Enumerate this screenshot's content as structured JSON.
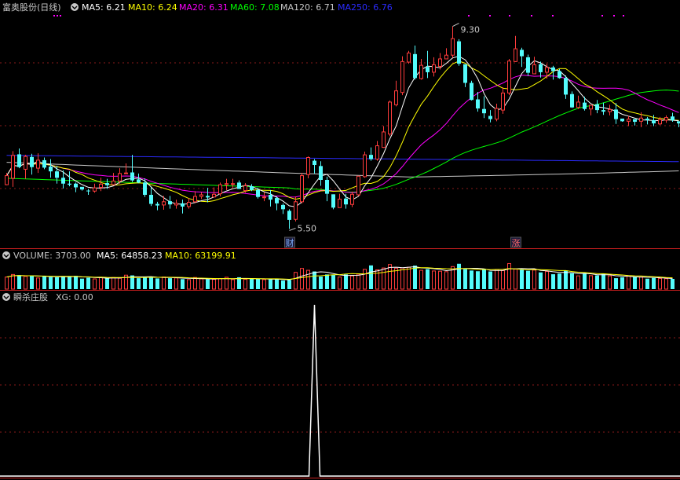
{
  "colors": {
    "up": "#ff3c3c",
    "down": "#54fcfc",
    "separator": "#c81e1e",
    "grid": "#8a1a1a",
    "text": "#c8c8c8",
    "ma5": "#ffffff",
    "ma10": "#ffff00",
    "ma20": "#ff00ff",
    "ma60": "#00ff00",
    "ma120": "#c8c8c8",
    "ma250": "#2b2bff",
    "white": "#ffffff"
  },
  "header": {
    "stock_name": "富奥股份(日线)",
    "ma5": "MA5: 6.21",
    "ma10": "MA10: 6.24",
    "ma20": "MA20: 6.31",
    "ma60": "MA60: 7.08",
    "ma120": "MA120: 6.71",
    "ma250": "MA250: 6.76"
  },
  "volume_header": {
    "name": "VOLUME: 3703.00",
    "ma5": "MA5: 64858.23",
    "ma10": "MA10: 63199.91"
  },
  "indicator_header": {
    "name": "瞬杀庄股",
    "xg": "XG: 0.00"
  },
  "annotations": {
    "high_label": "9.30",
    "low_label": "5.50",
    "marker_cai": "财",
    "marker_zhang": "涨"
  },
  "chart_data": [
    {
      "type": "candlestick",
      "title": "富奥股份(日线)",
      "price_range": [
        5.3,
        9.5
      ],
      "high": 9.3,
      "low": 5.5,
      "ohlc": [
        [
          6.33,
          6.5,
          6.32,
          6.55
        ],
        [
          6.45,
          6.88,
          6.29,
          6.96
        ],
        [
          6.9,
          6.66,
          6.64,
          7.01
        ],
        [
          6.62,
          6.86,
          6.44,
          6.89
        ],
        [
          6.85,
          6.66,
          6.52,
          6.91
        ],
        [
          6.64,
          6.79,
          6.55,
          6.92
        ],
        [
          6.79,
          6.65,
          6.62,
          6.84
        ],
        [
          6.67,
          6.58,
          6.46,
          6.81
        ],
        [
          6.58,
          6.46,
          6.35,
          6.68
        ],
        [
          6.46,
          6.35,
          6.26,
          6.6
        ],
        [
          6.35,
          6.33,
          6.3,
          6.58
        ],
        [
          6.35,
          6.28,
          6.19,
          6.37
        ],
        [
          6.29,
          6.24,
          6.22,
          6.25
        ],
        [
          6.22,
          6.21,
          6.14,
          6.25
        ],
        [
          6.21,
          6.27,
          6.18,
          6.35
        ],
        [
          6.28,
          6.34,
          6.21,
          6.46
        ],
        [
          6.36,
          6.32,
          6.25,
          6.44
        ],
        [
          6.33,
          6.4,
          6.32,
          6.55
        ],
        [
          6.4,
          6.54,
          6.35,
          6.64
        ],
        [
          6.55,
          6.55,
          6.54,
          6.73
        ],
        [
          6.56,
          6.41,
          6.38,
          6.89
        ],
        [
          6.43,
          6.37,
          6.36,
          6.54
        ],
        [
          6.37,
          6.14,
          6.1,
          6.45
        ],
        [
          6.14,
          5.97,
          5.93,
          6.28
        ],
        [
          5.97,
          5.94,
          5.85,
          6.01
        ],
        [
          5.95,
          6.01,
          5.86,
          6.12
        ],
        [
          6.02,
          5.96,
          5.88,
          6.12
        ],
        [
          5.95,
          5.98,
          5.88,
          6.05
        ],
        [
          5.98,
          5.92,
          5.79,
          6.05
        ],
        [
          5.92,
          6.0,
          5.88,
          6.08
        ],
        [
          6.01,
          6.11,
          5.99,
          6.21
        ],
        [
          6.11,
          6.14,
          6.06,
          6.19
        ],
        [
          6.12,
          6.09,
          6.0,
          6.27
        ],
        [
          6.1,
          6.15,
          6.1,
          6.28
        ],
        [
          6.16,
          6.33,
          6.11,
          6.37
        ],
        [
          6.33,
          6.35,
          6.23,
          6.44
        ],
        [
          6.35,
          6.35,
          6.27,
          6.44
        ],
        [
          6.37,
          6.25,
          6.25,
          6.41
        ],
        [
          6.22,
          6.31,
          6.18,
          6.36
        ],
        [
          6.3,
          6.23,
          6.21,
          6.34
        ],
        [
          6.23,
          6.1,
          6.07,
          6.27
        ],
        [
          6.1,
          6.1,
          6.02,
          6.19
        ],
        [
          6.14,
          6.05,
          5.92,
          6.23
        ],
        [
          6.08,
          5.98,
          5.85,
          6.11
        ],
        [
          5.95,
          5.87,
          5.78,
          5.98
        ],
        [
          5.84,
          5.67,
          5.5,
          5.87
        ],
        [
          5.68,
          6.01,
          5.64,
          6.11
        ],
        [
          6.01,
          6.5,
          5.98,
          6.55
        ],
        [
          6.52,
          6.84,
          6.45,
          6.86
        ],
        [
          6.78,
          6.7,
          6.54,
          6.81
        ],
        [
          6.68,
          6.42,
          6.31,
          6.77
        ],
        [
          6.42,
          6.16,
          6.02,
          6.48
        ],
        [
          6.15,
          5.9,
          5.87,
          6.15
        ],
        [
          5.9,
          6.06,
          5.91,
          6.16
        ],
        [
          6.07,
          5.96,
          5.88,
          6.16
        ],
        [
          5.96,
          6.15,
          5.91,
          6.2
        ],
        [
          6.14,
          6.49,
          6.12,
          6.49
        ],
        [
          6.48,
          6.89,
          6.46,
          6.95
        ],
        [
          6.89,
          6.81,
          6.78,
          7.03
        ],
        [
          6.81,
          7.06,
          6.78,
          7.15
        ],
        [
          7.03,
          7.32,
          7.02,
          7.43
        ],
        [
          7.28,
          7.88,
          7.24,
          7.91
        ],
        [
          7.83,
          8.09,
          7.8,
          8.28
        ],
        [
          8.06,
          8.64,
          8.01,
          8.74
        ],
        [
          8.63,
          8.8,
          8.6,
          8.84
        ],
        [
          8.78,
          8.33,
          8.3,
          8.94
        ],
        [
          8.32,
          8.57,
          8.3,
          8.69
        ],
        [
          8.54,
          8.44,
          8.33,
          8.84
        ],
        [
          8.44,
          8.58,
          8.36,
          8.72
        ],
        [
          8.55,
          8.69,
          8.49,
          8.8
        ],
        [
          8.69,
          8.76,
          8.69,
          8.89
        ],
        [
          8.76,
          9.07,
          8.71,
          9.3
        ],
        [
          9.02,
          8.6,
          8.56,
          9.06
        ],
        [
          8.59,
          8.24,
          8.16,
          8.57
        ],
        [
          8.24,
          7.92,
          7.91,
          8.28
        ],
        [
          7.93,
          7.76,
          7.7,
          8.07
        ],
        [
          7.75,
          7.67,
          7.58,
          7.99
        ],
        [
          7.62,
          7.56,
          7.5,
          7.73
        ],
        [
          7.56,
          7.76,
          7.52,
          7.85
        ],
        [
          7.73,
          8.05,
          7.66,
          8.16
        ],
        [
          8.05,
          8.65,
          8.01,
          8.69
        ],
        [
          8.64,
          8.88,
          8.63,
          9.12
        ],
        [
          8.86,
          8.74,
          8.54,
          8.9
        ],
        [
          8.72,
          8.43,
          8.37,
          8.77
        ],
        [
          8.41,
          8.58,
          8.41,
          8.73
        ],
        [
          8.59,
          8.44,
          8.34,
          8.64
        ],
        [
          8.44,
          8.53,
          8.32,
          8.6
        ],
        [
          8.53,
          8.46,
          8.3,
          8.56
        ],
        [
          8.46,
          8.33,
          8.32,
          8.5
        ],
        [
          8.33,
          8.02,
          7.94,
          8.38
        ],
        [
          8.03,
          7.78,
          7.77,
          8.08
        ],
        [
          7.78,
          7.88,
          7.75,
          8.0
        ],
        [
          7.87,
          7.75,
          7.72,
          7.98
        ],
        [
          7.75,
          7.82,
          7.63,
          7.82
        ],
        [
          7.84,
          7.73,
          7.67,
          7.92
        ],
        [
          7.73,
          7.7,
          7.64,
          7.87
        ],
        [
          7.7,
          7.74,
          7.63,
          7.83
        ],
        [
          7.74,
          7.56,
          7.47,
          7.86
        ],
        [
          7.57,
          7.52,
          7.51,
          7.55
        ],
        [
          7.52,
          7.56,
          7.43,
          7.62
        ],
        [
          7.56,
          7.51,
          7.44,
          7.54
        ],
        [
          7.52,
          7.58,
          7.41,
          7.69
        ],
        [
          7.57,
          7.54,
          7.46,
          7.6
        ],
        [
          7.54,
          7.48,
          7.43,
          7.64
        ],
        [
          7.47,
          7.55,
          7.45,
          7.6
        ],
        [
          7.54,
          7.59,
          7.49,
          7.63
        ],
        [
          7.61,
          7.54,
          7.51,
          7.68
        ],
        [
          7.52,
          7.48,
          7.41,
          7.52
        ]
      ],
      "series": [
        {
          "name": "MA5",
          "last": 6.21
        },
        {
          "name": "MA10",
          "last": 6.24
        },
        {
          "name": "MA20",
          "last": 6.31
        },
        {
          "name": "MA60",
          "last": 7.08
        },
        {
          "name": "MA120",
          "last": 6.71
        },
        {
          "name": "MA250",
          "last": 6.76
        }
      ]
    },
    {
      "type": "bar",
      "title": "VOLUME",
      "last": 3703.0,
      "ma5": 64858.23,
      "ma10": 63199.91,
      "values": [
        52000,
        63000,
        60000,
        55000,
        58000,
        48000,
        57000,
        52000,
        51000,
        56000,
        53000,
        57000,
        45000,
        49000,
        44000,
        50000,
        47000,
        50000,
        47000,
        60000,
        59000,
        47000,
        51000,
        52000,
        46000,
        52000,
        47000,
        48000,
        43000,
        41000,
        50000,
        44000,
        42000,
        42000,
        45000,
        51000,
        41000,
        51000,
        42000,
        44000,
        44000,
        41000,
        42000,
        43000,
        37000,
        39000,
        72000,
        89000,
        81000,
        76000,
        54000,
        63000,
        61000,
        52000,
        63000,
        57000,
        64000,
        85000,
        102000,
        83000,
        91000,
        106000,
        90000,
        91000,
        94000,
        101000,
        81000,
        86000,
        78000,
        77000,
        75000,
        97000,
        109000,
        86000,
        80000,
        77000,
        85000,
        76000,
        84000,
        80000,
        110000,
        86000,
        83000,
        79000,
        82000,
        72000,
        76000,
        64000,
        67000,
        80000,
        68000,
        57000,
        67000,
        58000,
        59000,
        66000,
        57000,
        47000,
        51000,
        56000,
        52000,
        52000,
        45000,
        48000,
        46000,
        45000,
        44000
      ]
    },
    {
      "type": "line",
      "title": "瞬杀庄股",
      "series": [
        {
          "name": "XG",
          "last": 0.0,
          "signal_index": 49,
          "ylim": [
            0,
            1
          ]
        }
      ]
    }
  ]
}
